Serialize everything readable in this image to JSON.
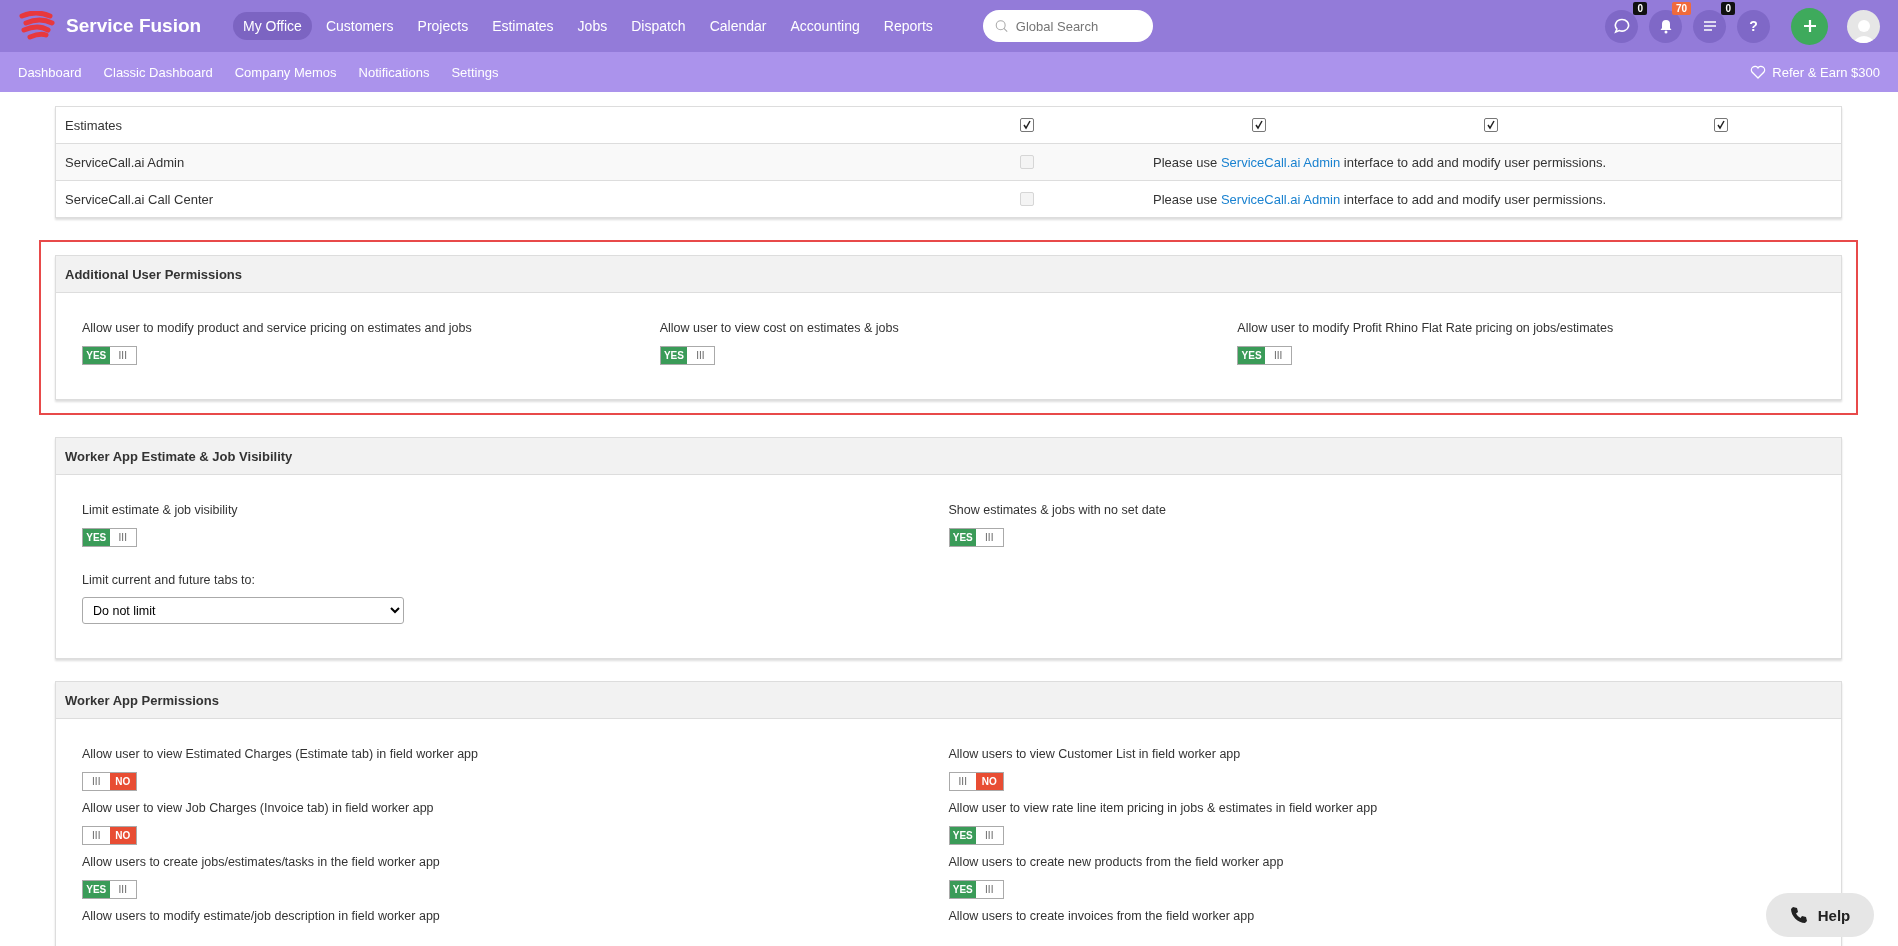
{
  "brand": "Service Fusion",
  "nav": [
    {
      "label": "My Office",
      "selected": true
    },
    {
      "label": "Customers",
      "selected": false
    },
    {
      "label": "Projects",
      "selected": false
    },
    {
      "label": "Estimates",
      "selected": false
    },
    {
      "label": "Jobs",
      "selected": false
    },
    {
      "label": "Dispatch",
      "selected": false
    },
    {
      "label": "Calendar",
      "selected": false
    },
    {
      "label": "Accounting",
      "selected": false
    },
    {
      "label": "Reports",
      "selected": false
    }
  ],
  "search": {
    "placeholder": "Global Search"
  },
  "header_icons": [
    {
      "kind": "chat",
      "badge": "0",
      "color": "#111111"
    },
    {
      "kind": "bell",
      "badge": "70",
      "color": "#f06a3c"
    },
    {
      "kind": "list",
      "badge": "0",
      "color": "#111111"
    },
    {
      "kind": "help",
      "glyph": "?"
    }
  ],
  "subnav": [
    "Dashboard",
    "Classic Dashboard",
    "Company Memos",
    "Notifications",
    "Settings"
  ],
  "refer": "Refer & Earn $300",
  "table_rows": [
    {
      "label": "Estimates",
      "checks": [
        {
          "checked": true,
          "disabled": false
        },
        {
          "checked": true,
          "disabled": false
        },
        {
          "checked": true,
          "disabled": false
        },
        {
          "checked": true,
          "disabled": false
        }
      ]
    },
    {
      "label": "ServiceCall.ai Admin",
      "checks": [
        {
          "checked": false,
          "disabled": true
        }
      ],
      "message": {
        "before": "Please use ",
        "link": "ServiceCall.ai Admin",
        "after": " interface to add and modify user permissions."
      }
    },
    {
      "label": "ServiceCall.ai Call Center",
      "checks": [
        {
          "checked": false,
          "disabled": true
        }
      ],
      "message": {
        "before": "Please use ",
        "link": "ServiceCall.ai Admin",
        "after": " interface to add and modify user permissions."
      }
    }
  ],
  "sections": [
    {
      "title": "Additional User Permissions",
      "highlighted": true,
      "items": [
        {
          "label": "Allow user to modify product and service pricing on estimates and jobs",
          "on": true,
          "state_text": "YES",
          "grip": "III"
        },
        {
          "label": "Allow user to view cost on estimates & jobs",
          "on": true,
          "state_text": "YES",
          "grip": "III"
        },
        {
          "label": "Allow user to modify Profit Rhino Flat Rate pricing on jobs/estimates",
          "on": true,
          "state_text": "YES",
          "grip": "III"
        }
      ]
    },
    {
      "title": "Worker App Estimate & Job Visibility",
      "highlighted": false,
      "items": [
        {
          "label": "Limit estimate & job visibility",
          "on": true,
          "state_text": "YES",
          "grip": "III"
        },
        {
          "label": "Show estimates & jobs with no set date",
          "on": true,
          "state_text": "YES",
          "grip": "III"
        }
      ],
      "select": {
        "label": "Limit current and future tabs to:",
        "value": "Do not limit"
      }
    },
    {
      "title": "Worker App Permissions",
      "highlighted": false,
      "items": [
        {
          "label": "Allow user to view Estimated Charges (Estimate tab) in field worker app",
          "on": false,
          "state_text": "NO",
          "grip": "III"
        },
        {
          "label": "Allow users to view Customer List in field worker app",
          "on": false,
          "state_text": "NO",
          "grip": "III"
        },
        {
          "label": "Allow user to view Job Charges (Invoice tab) in field worker app",
          "on": false,
          "state_text": "NO",
          "grip": "III"
        },
        {
          "label": "Allow user to view rate line item pricing in jobs & estimates in field worker app",
          "on": true,
          "state_text": "YES",
          "grip": "III"
        },
        {
          "label": "Allow users to create jobs/estimates/tasks in the field worker app",
          "on": true,
          "state_text": "YES",
          "grip": "III"
        },
        {
          "label": "Allow users to create new products from the field worker app",
          "on": true,
          "state_text": "YES",
          "grip": "III"
        },
        {
          "label": "Allow users to modify estimate/job description in field worker app"
        },
        {
          "label": "Allow users to create invoices from the field worker app"
        }
      ]
    }
  ],
  "help": "Help"
}
